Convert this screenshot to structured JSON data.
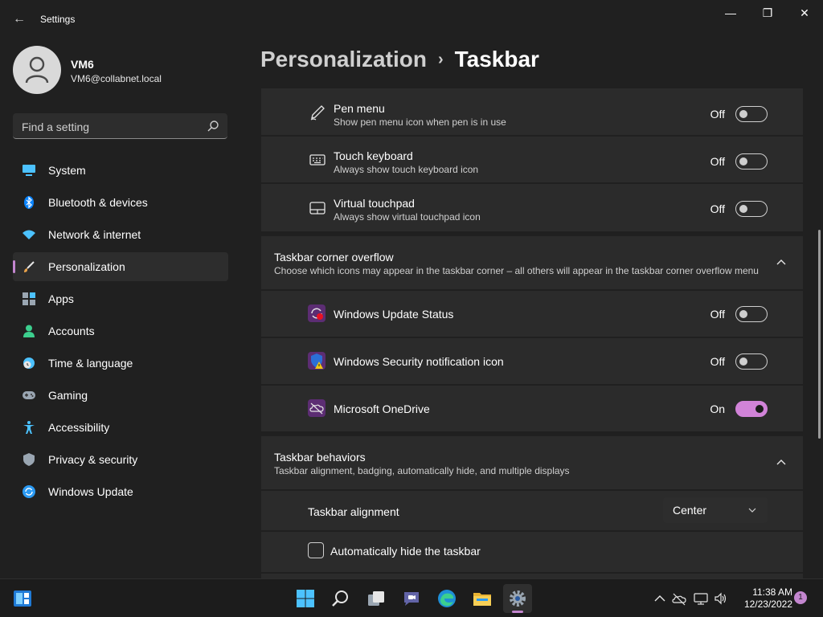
{
  "window": {
    "title": "Settings",
    "back_glyph": "←",
    "min_glyph": "—",
    "max_glyph": "❐",
    "close_glyph": "✕"
  },
  "profile": {
    "name": "VM6",
    "email": "VM6@collabnet.local"
  },
  "search": {
    "placeholder": "Find a setting"
  },
  "nav": [
    {
      "label": "System",
      "icon": "monitor-icon",
      "color": "#4cc2ff"
    },
    {
      "label": "Bluetooth & devices",
      "icon": "bluetooth-icon",
      "color": "#0a84ff"
    },
    {
      "label": "Network & internet",
      "icon": "wifi-icon",
      "color": "#4cc2ff"
    },
    {
      "label": "Personalization",
      "icon": "brush-icon",
      "color": "#e8a24a",
      "active": true
    },
    {
      "label": "Apps",
      "icon": "apps-icon",
      "color": "#9aa6b2"
    },
    {
      "label": "Accounts",
      "icon": "person-icon",
      "color": "#3ccf8e"
    },
    {
      "label": "Time & language",
      "icon": "globe-clock-icon",
      "color": "#4cc2ff"
    },
    {
      "label": "Gaming",
      "icon": "gamepad-icon",
      "color": "#9aa6b2"
    },
    {
      "label": "Accessibility",
      "icon": "accessibility-icon",
      "color": "#4cc2ff"
    },
    {
      "label": "Privacy & security",
      "icon": "shield-icon",
      "color": "#9aa6b2"
    },
    {
      "label": "Windows Update",
      "icon": "update-icon",
      "color": "#2b9af3"
    }
  ],
  "breadcrumb": {
    "parent": "Personalization",
    "separator": "›",
    "current": "Taskbar"
  },
  "corner_icons": [
    {
      "title": "Pen menu",
      "subtitle": "Show pen menu icon when pen is in use",
      "state": "Off",
      "on": false,
      "icon": "pen-icon"
    },
    {
      "title": "Touch keyboard",
      "subtitle": "Always show touch keyboard icon",
      "state": "Off",
      "on": false,
      "icon": "keyboard-icon"
    },
    {
      "title": "Virtual touchpad",
      "subtitle": "Always show virtual touchpad icon",
      "state": "Off",
      "on": false,
      "icon": "touchpad-icon"
    }
  ],
  "overflow_section": {
    "title": "Taskbar corner overflow",
    "subtitle": "Choose which icons may appear in the taskbar corner – all others will appear in the taskbar corner overflow menu",
    "items": [
      {
        "title": "Windows Update Status",
        "state": "Off",
        "on": false,
        "icon": "windows-update-status-icon"
      },
      {
        "title": "Windows Security notification icon",
        "state": "Off",
        "on": false,
        "icon": "windows-security-icon"
      },
      {
        "title": "Microsoft OneDrive",
        "state": "On",
        "on": true,
        "icon": "onedrive-icon"
      }
    ]
  },
  "behaviors_section": {
    "title": "Taskbar behaviors",
    "subtitle": "Taskbar alignment, badging, automatically hide, and multiple displays",
    "alignment_label": "Taskbar alignment",
    "alignment_value": "Center",
    "autohide_label": "Automatically hide the taskbar",
    "autohide_checked": false
  },
  "taskbar": {
    "apps": [
      "widgets-icon",
      "start-icon",
      "search-icon",
      "task-view-icon",
      "teams-chat-icon",
      "edge-icon",
      "file-explorer-icon",
      "settings-icon"
    ],
    "active_app": "settings-icon",
    "time": "11:38 AM",
    "date": "12/23/2022",
    "notification_count": "1"
  },
  "colors": {
    "accent": "#c386cf",
    "toggle_on": "#d183d8",
    "background": "#202020",
    "card": "#2b2b2b"
  }
}
